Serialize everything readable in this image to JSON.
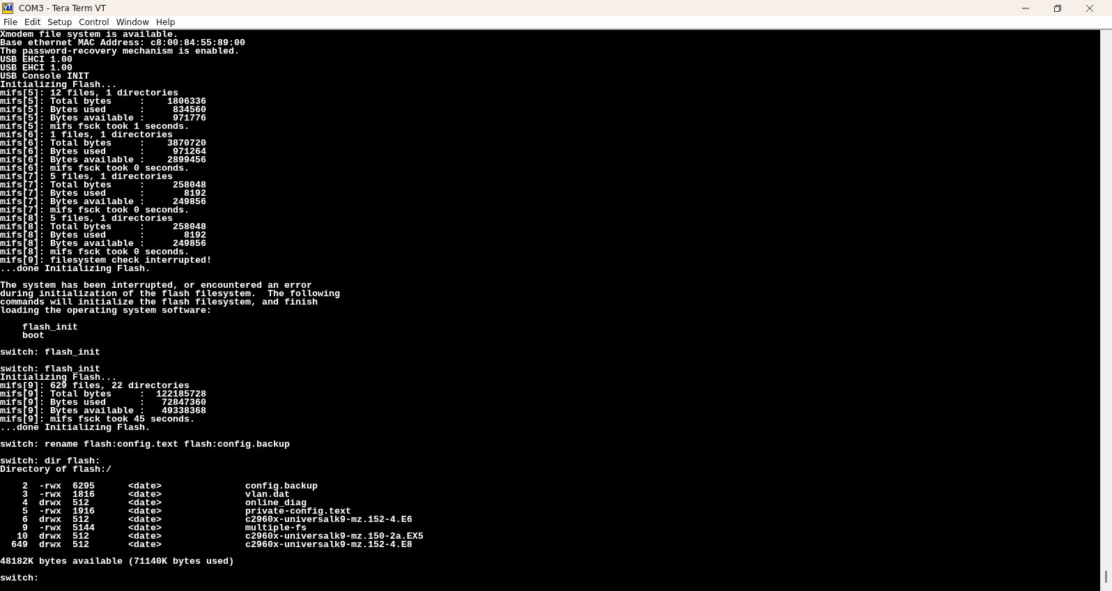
{
  "window": {
    "title": "COM3 - Tera Term VT"
  },
  "menu": [
    "File",
    "Edit",
    "Setup",
    "Control",
    "Window",
    "Help"
  ],
  "terminal": {
    "blocks": [
      {
        "lines": [
          "Xmodem file system is available.",
          "Base ethernet MAC Address: c8:00:84:55:89:00",
          "The password-recovery mechanism is enabled.",
          "USB EHCI 1.00",
          "USB EHCI 1.00",
          "USB Console INIT",
          "Initializing Flash...",
          "mifs[5]: 12 files, 1 directories",
          "mifs[5]: Total bytes     :    1806336",
          "mifs[5]: Bytes used      :     834560",
          "mifs[5]: Bytes available :     971776",
          "mifs[5]: mifs fsck took 1 seconds.",
          "mifs[6]: 1 files, 1 directories",
          "mifs[6]: Total bytes     :    3870720",
          "mifs[6]: Bytes used      :     971264",
          "mifs[6]: Bytes available :    2899456",
          "mifs[6]: mifs fsck took 0 seconds.",
          "mifs[7]: 5 files, 1 directories",
          "mifs[7]: Total bytes     :     258048",
          "mifs[7]: Bytes used      :       8192",
          "mifs[7]: Bytes available :     249856",
          "mifs[7]: mifs fsck took 0 seconds.",
          "mifs[8]: 5 files, 1 directories",
          "mifs[8]: Total bytes     :     258048",
          "mifs[8]: Bytes used      :       8192",
          "mifs[8]: Bytes available :     249856",
          "mifs[8]: mifs fsck took 0 seconds.",
          "mifs[9]: filesystem check interrupted!",
          "...done Initializing Flash."
        ]
      },
      {
        "lines": [
          "The system has been interrupted, or encountered an error",
          "during initialization of the flash filesystem.  The following",
          "commands will initialize the flash filesystem, and finish",
          "loading the operating system software:"
        ]
      },
      {
        "lines": [
          "    flash_init",
          "    boot"
        ]
      },
      {
        "lines": [
          "switch: flash_init"
        ]
      },
      {
        "lines": [
          "switch: flash_init",
          "Initializing Flash...",
          "mifs[9]: 629 files, 22 directories",
          "mifs[9]: Total bytes     :  122185728",
          "mifs[9]: Bytes used      :   72847360",
          "mifs[9]: Bytes available :   49338368",
          "mifs[9]: mifs fsck took 45 seconds.",
          "...done Initializing Flash."
        ]
      },
      {
        "lines": [
          "switch: rename flash:config.text flash:config.backup"
        ]
      },
      {
        "lines": [
          "switch: dir flash:",
          "Directory of flash:/"
        ]
      },
      {
        "lines": [
          "    2  -rwx  6295      <date>               config.backup",
          "    3  -rwx  1816      <date>               vlan.dat",
          "    4  drwx  512       <date>               online_diag",
          "    5  -rwx  1916      <date>               private-config.text",
          "    6  drwx  512       <date>               c2960x-universalk9-mz.152-4.E6",
          "    9  -rwx  5144      <date>               multiple-fs",
          "   10  drwx  512       <date>               c2960x-universalk9-mz.150-2a.EX5",
          "  649  drwx  512       <date>               c2960x-universalk9-mz.152-4.E8"
        ]
      },
      {
        "lines": [
          "48182K bytes available (71140K bytes used)"
        ]
      },
      {
        "lines": [
          "switch:"
        ]
      }
    ]
  }
}
